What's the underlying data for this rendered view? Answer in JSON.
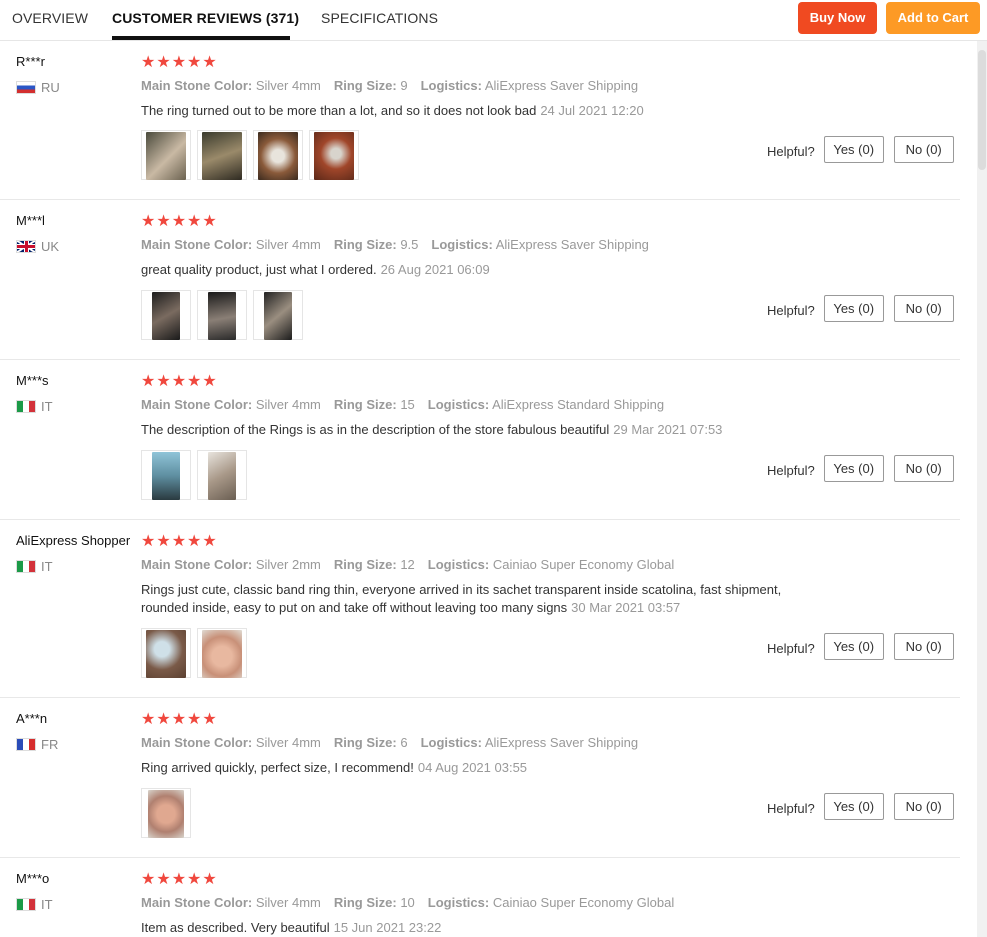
{
  "tabs": {
    "overview": "OVERVIEW",
    "reviews": "CUSTOMER REVIEWS (371)",
    "specs": "SPECIFICATIONS"
  },
  "actions": {
    "buy_now": "Buy Now",
    "add_to_cart": "Add to Cart"
  },
  "colors": {
    "buy": "#f04a21",
    "cart": "#fd9a25",
    "stars": "#f0483e"
  },
  "labels": {
    "stone": "Main Stone Color:",
    "size": "Ring Size:",
    "logistics": "Logistics:",
    "helpful": "Helpful?",
    "yes": "Yes (0)",
    "no": "No (0)"
  },
  "reviews": [
    {
      "user": "R***r",
      "country": "RU",
      "flag": "ru",
      "stars": "★★★★★",
      "stone": "Silver 4mm",
      "size": "9",
      "logistics": "AliExpress Saver Shipping",
      "text": "The ring turned out to be more than a lot, and so it does not look bad",
      "date": "24 Jul 2021 12:20"
    },
    {
      "user": "M***l",
      "country": "UK",
      "flag": "uk",
      "stars": "★★★★★",
      "stone": "Silver 4mm",
      "size": "9.5",
      "logistics": "AliExpress Saver Shipping",
      "text": "great quality product, just what I ordered.",
      "date": "26 Aug 2021 06:09"
    },
    {
      "user": "M***s",
      "country": "IT",
      "flag": "it",
      "stars": "★★★★★",
      "stone": "Silver 4mm",
      "size": "15",
      "logistics": "AliExpress Standard Shipping",
      "text": "The description of the Rings is as in the description of the store fabulous beautiful",
      "date": "29 Mar 2021 07:53"
    },
    {
      "user": "AliExpress Shopper",
      "country": "IT",
      "flag": "it",
      "stars": "★★★★★",
      "stone": "Silver 2mm",
      "size": "12",
      "logistics": "Cainiao Super Economy Global",
      "text": "Rings just cute, classic band ring thin, everyone arrived in its sachet transparent inside scatolina, fast shipment, rounded inside, easy to put on and take off without leaving too many signs",
      "date": "30 Mar 2021 03:57"
    },
    {
      "user": "A***n",
      "country": "FR",
      "flag": "fr",
      "stars": "★★★★★",
      "stone": "Silver 4mm",
      "size": "6",
      "logistics": "AliExpress Saver Shipping",
      "text": "Ring arrived quickly, perfect size, I recommend!",
      "date": "04 Aug 2021 03:55"
    },
    {
      "user": "M***o",
      "country": "IT",
      "flag": "it",
      "stars": "★★★★★",
      "stone": "Silver 4mm",
      "size": "10",
      "logistics": "Cainiao Super Economy Global",
      "text": "Item as described. Very beautiful",
      "date": "15 Jun 2021 23:22"
    }
  ]
}
